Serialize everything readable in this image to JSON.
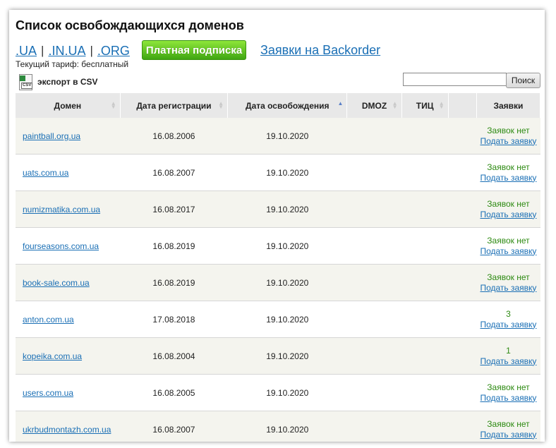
{
  "title": "Список освобождающихся доменов",
  "tld_links": [
    ".UA",
    ".IN.UA",
    ".ORG"
  ],
  "tld_separator": "|",
  "paid_button": "Платная подписка",
  "backorder_link": "Заявки на Backorder",
  "tariff": "Текущий тариф: бесплатный",
  "export": {
    "label": "экспорт в CSV",
    "icon": "csv-file-icon",
    "icon_tag": "CSV"
  },
  "search": {
    "button": "Поиск",
    "value": ""
  },
  "table": {
    "headers": [
      "Домен",
      "Дата регистрации",
      "Дата освобождения",
      "DMOZ",
      "ТИЦ",
      "",
      "Заявки"
    ],
    "sorted_column": "Дата освобождения",
    "submit_label": "Подать заявку",
    "rows": [
      {
        "domain": "paintball.org.ua",
        "reg": "16.08.2006",
        "free": "19.10.2020",
        "dmoz": "",
        "tic": "",
        "requests": "Заявок нет"
      },
      {
        "domain": "uats.com.ua",
        "reg": "16.08.2007",
        "free": "19.10.2020",
        "dmoz": "",
        "tic": "",
        "requests": "Заявок нет"
      },
      {
        "domain": "numizmatika.com.ua",
        "reg": "16.08.2017",
        "free": "19.10.2020",
        "dmoz": "",
        "tic": "",
        "requests": "Заявок нет"
      },
      {
        "domain": "fourseasons.com.ua",
        "reg": "16.08.2019",
        "free": "19.10.2020",
        "dmoz": "",
        "tic": "",
        "requests": "Заявок нет"
      },
      {
        "domain": "book-sale.com.ua",
        "reg": "16.08.2019",
        "free": "19.10.2020",
        "dmoz": "",
        "tic": "",
        "requests": "Заявок нет"
      },
      {
        "domain": "anton.com.ua",
        "reg": "17.08.2018",
        "free": "19.10.2020",
        "dmoz": "",
        "tic": "",
        "requests": "3"
      },
      {
        "domain": "kopeika.com.ua",
        "reg": "16.08.2004",
        "free": "19.10.2020",
        "dmoz": "",
        "tic": "",
        "requests": "1"
      },
      {
        "domain": "users.com.ua",
        "reg": "16.08.2005",
        "free": "19.10.2020",
        "dmoz": "",
        "tic": "",
        "requests": "Заявок нет"
      },
      {
        "domain": "ukrbudmontazh.com.ua",
        "reg": "16.08.2007",
        "free": "19.10.2020",
        "dmoz": "",
        "tic": "",
        "requests": "Заявок нет"
      }
    ]
  },
  "colors": {
    "link": "#1a6fb5",
    "status_green": "#2d8a12",
    "paid_button": "#5cc21f",
    "header_bg": "#e8e8e8",
    "row_alt": "#f4f4ee"
  }
}
